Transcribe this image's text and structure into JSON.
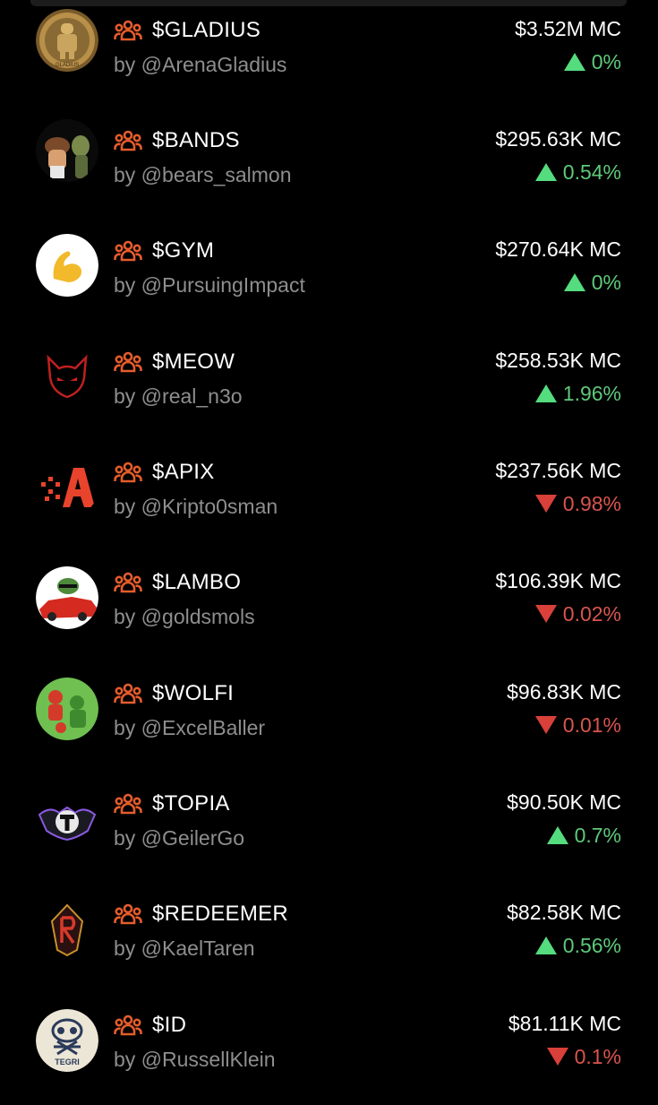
{
  "colors": {
    "accent": "#e45c2c",
    "up": "#5ec97a",
    "down": "#d9544f",
    "background": "#000000",
    "muted": "#8e8e8e"
  },
  "rows": [
    {
      "ticker": "$GLADIUS",
      "creator": "by @ArenaGladius",
      "mc": "$3.52M MC",
      "change": "0%",
      "direction": "up",
      "avatar_text": "GLADIUS"
    },
    {
      "ticker": "$BANDS",
      "creator": "by @bears_salmon",
      "mc": "$295.63K MC",
      "change": "0.54%",
      "direction": "up"
    },
    {
      "ticker": "$GYM",
      "creator": "by @PursuingImpact",
      "mc": "$270.64K MC",
      "change": "0%",
      "direction": "up"
    },
    {
      "ticker": "$MEOW",
      "creator": "by @real_n3o",
      "mc": "$258.53K MC",
      "change": "1.96%",
      "direction": "up"
    },
    {
      "ticker": "$APIX",
      "creator": "by @Kripto0sman",
      "mc": "$237.56K MC",
      "change": "0.98%",
      "direction": "down"
    },
    {
      "ticker": "$LAMBO",
      "creator": "by @goldsmols",
      "mc": "$106.39K MC",
      "change": "0.02%",
      "direction": "down"
    },
    {
      "ticker": "$WOLFI",
      "creator": "by @ExcelBaller",
      "mc": "$96.83K MC",
      "change": "0.01%",
      "direction": "down"
    },
    {
      "ticker": "$TOPIA",
      "creator": "by @GeilerGo",
      "mc": "$90.50K MC",
      "change": "0.7%",
      "direction": "up"
    },
    {
      "ticker": "$REDEEMER",
      "creator": "by @KaelTaren",
      "mc": "$82.58K MC",
      "change": "0.56%",
      "direction": "up"
    },
    {
      "ticker": "$ID",
      "creator": "by @RussellKlein",
      "mc": "$81.11K MC",
      "change": "0.1%",
      "direction": "down",
      "avatar_text": "TEGRI"
    }
  ]
}
